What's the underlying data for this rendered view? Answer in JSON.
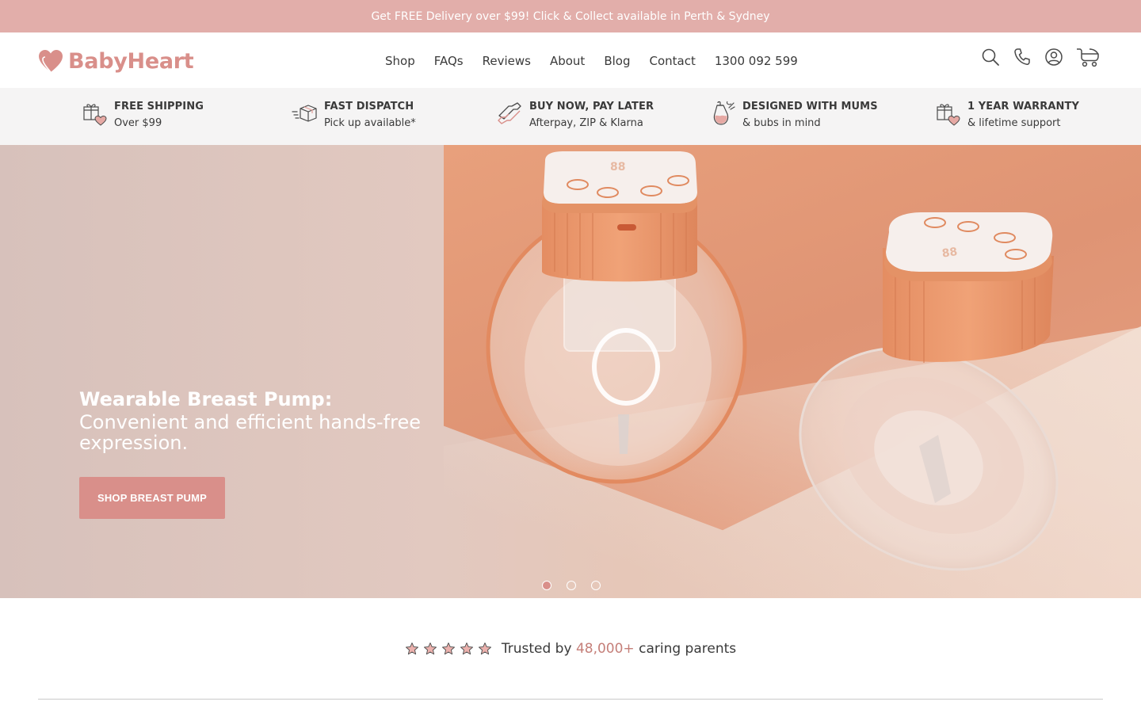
{
  "announcement": "Get FREE Delivery over $99! Click & Collect available in Perth & Sydney",
  "brand": {
    "name": "BabyHeart",
    "accent": "#d98f8a"
  },
  "nav": {
    "items": [
      "Shop",
      "FAQs",
      "Reviews",
      "About",
      "Blog",
      "Contact"
    ],
    "phone": "1300 092 599"
  },
  "tools": [
    "search-icon",
    "phone-icon",
    "account-icon",
    "cart-icon"
  ],
  "usps": [
    {
      "title": "FREE SHIPPING",
      "subtitle": "Over $99",
      "icon": "gift-heart-icon"
    },
    {
      "title": "FAST DISPATCH",
      "subtitle": "Pick up available*",
      "icon": "box-icon"
    },
    {
      "title": "BUY NOW, PAY LATER",
      "subtitle": "Afterpay, ZIP & Klarna",
      "icon": "repeat-icon"
    },
    {
      "title": "DESIGNED WITH MUMS",
      "subtitle": "& bubs in mind",
      "icon": "bottle-icon"
    },
    {
      "title": "1 YEAR WARRANTY",
      "subtitle": "& lifetime support",
      "icon": "gift-heart-icon"
    }
  ],
  "hero": {
    "headline": "Wearable Breast Pump:",
    "subheadline": "Convenient and efficient hands-free expression.",
    "cta": "SHOP BREAST PUMP",
    "slides": 3,
    "active_slide": 1
  },
  "trust": {
    "rating": 5,
    "prefix": "Trusted by ",
    "count": "48,000+",
    "suffix": " caring parents"
  }
}
